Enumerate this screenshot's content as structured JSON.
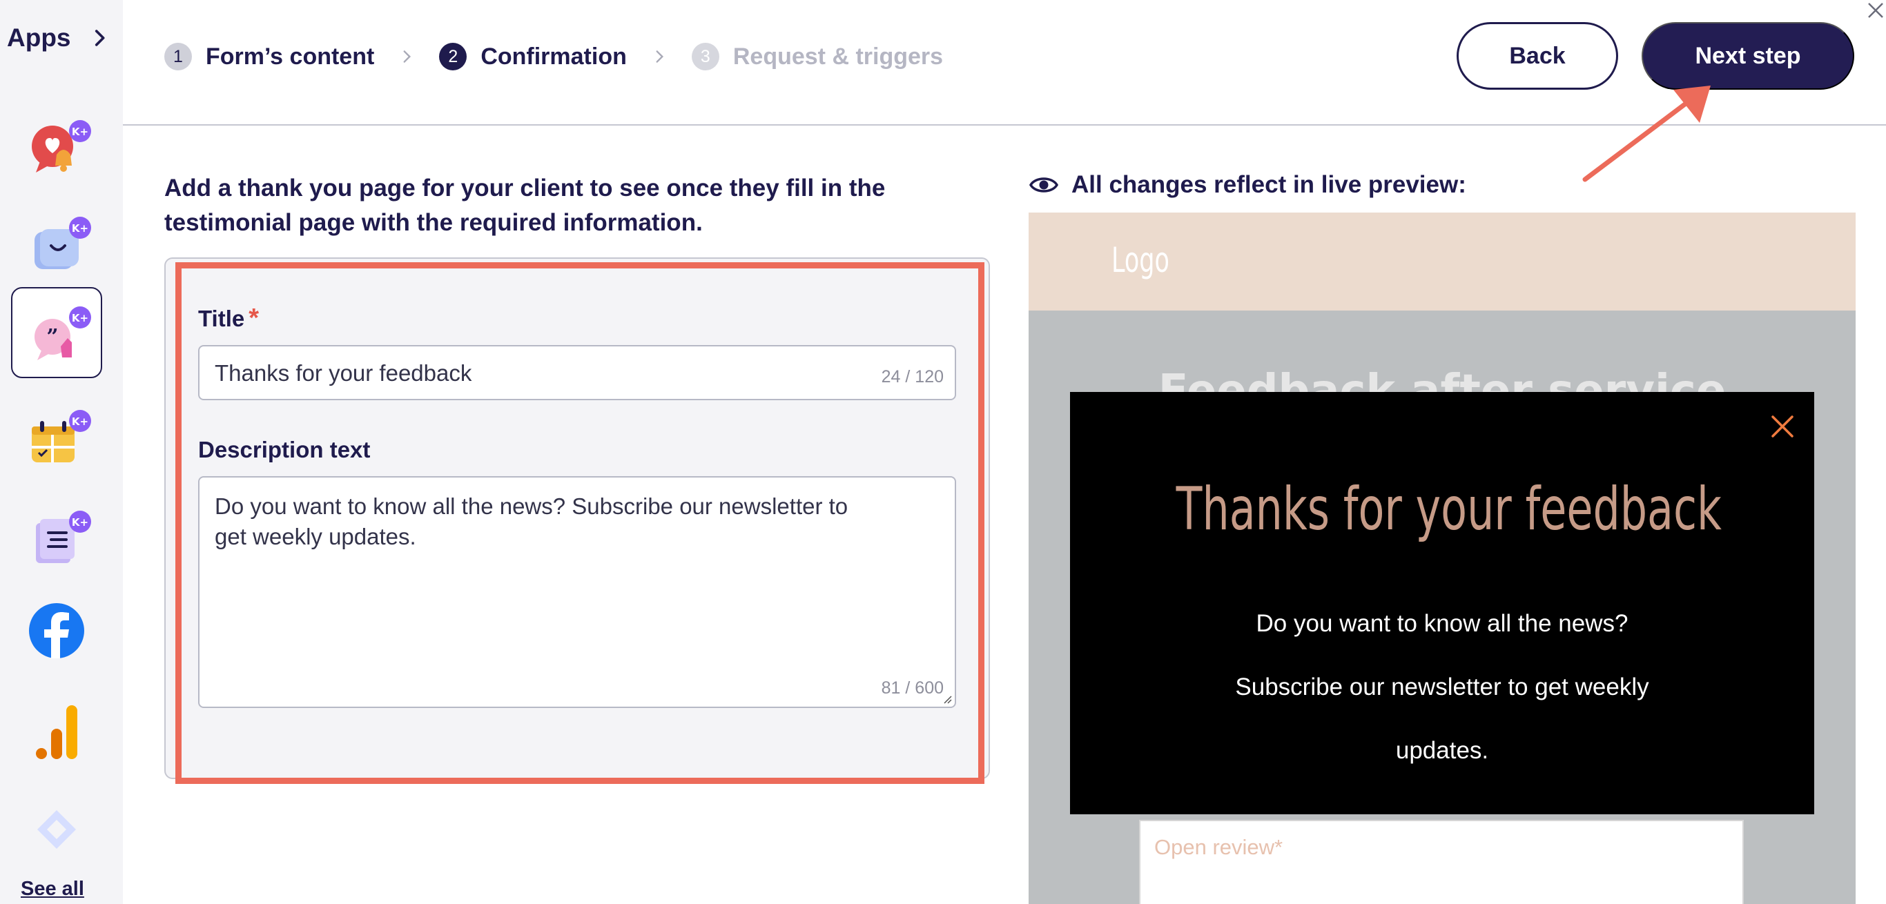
{
  "sidebar": {
    "title": "Apps",
    "apps": [
      {
        "icon": "heart-bubble-bell-icon",
        "badge": "K+"
      },
      {
        "icon": "shopping-bag-icon",
        "badge": "K+"
      },
      {
        "icon": "quote-bubble-icon",
        "badge": "K+",
        "active": true
      },
      {
        "icon": "calendar-icon",
        "badge": "K+"
      },
      {
        "icon": "document-list-icon",
        "badge": "K+"
      },
      {
        "icon": "facebook-icon"
      },
      {
        "icon": "analytics-bars-icon"
      },
      {
        "icon": "diamond-icon"
      }
    ],
    "see_all": "See all"
  },
  "header": {
    "steps": [
      {
        "num": "1",
        "label": "Form’s content",
        "state": "done"
      },
      {
        "num": "2",
        "label": "Confirmation",
        "state": "active"
      },
      {
        "num": "3",
        "label": "Request & triggers",
        "state": "future"
      }
    ],
    "back_label": "Back",
    "next_label": "Next step"
  },
  "form": {
    "intro": "Add a thank you page for your client to see once they fill in the testimonial page with the required information.",
    "title_label": "Title",
    "required_mark": "*",
    "title_value": "Thanks for your feedback",
    "title_counter": "24 / 120",
    "description_label": "Description text",
    "description_value": "Do you want to know all the news? Subscribe our newsletter to get weekly updates.",
    "description_counter": "81 / 600"
  },
  "preview": {
    "live_label": "All changes reflect in live preview:",
    "logo": "Logo",
    "background_title": "Feedback after service",
    "modal_title": "Thanks for your feedback",
    "modal_text": "Do you want to know all the news? Subscribe our newsletter to get weekly updates.",
    "field_placeholder": "Open review*"
  },
  "colors": {
    "primary": "#1f1b4d",
    "next_button": "#231d53",
    "highlight": "#ec6b5a",
    "modal_title": "#c69b87",
    "preview_header": "#ecdbce"
  }
}
